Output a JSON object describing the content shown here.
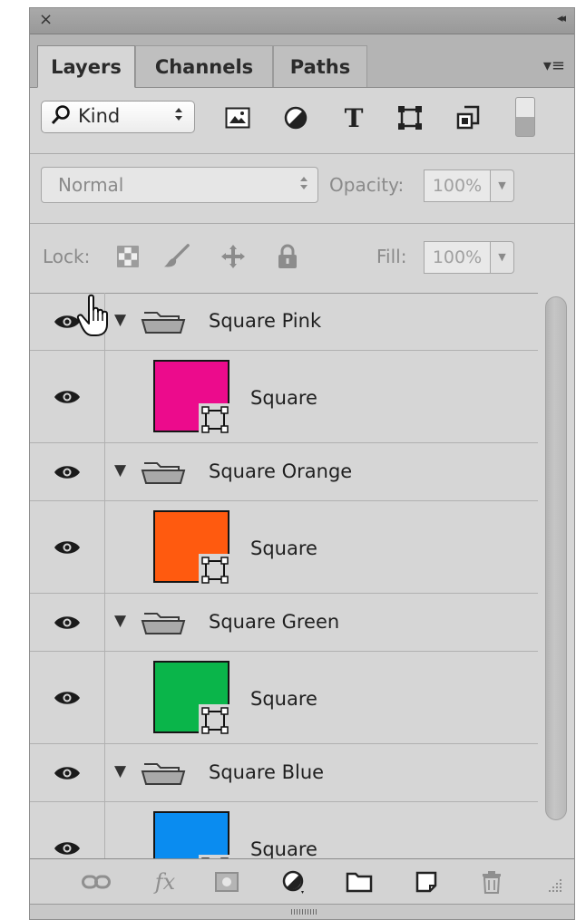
{
  "panel": {
    "close_glyph": "×",
    "collapse_glyph": "◂◂",
    "menu_glyph": "▾≡",
    "tabs": [
      {
        "label": "Layers",
        "active": true
      },
      {
        "label": "Channels",
        "active": false
      },
      {
        "label": "Paths",
        "active": false
      }
    ]
  },
  "filter": {
    "kind_label": "Kind",
    "icons": [
      "image-filter-icon",
      "adjustment-filter-icon",
      "type-filter-icon",
      "shape-filter-icon",
      "smart-object-filter-icon"
    ],
    "type_glyph": "T"
  },
  "blend": {
    "mode": "Normal",
    "opacity_label": "Opacity:",
    "opacity_value": "100%"
  },
  "lock": {
    "label": "Lock:",
    "fill_label": "Fill:",
    "fill_value": "100%"
  },
  "layers": [
    {
      "type": "group",
      "name": "Square Pink",
      "visible": true
    },
    {
      "type": "shape",
      "name": "Square",
      "color": "#ec0b8c",
      "visible": true
    },
    {
      "type": "group",
      "name": "Square Orange",
      "visible": true
    },
    {
      "type": "shape",
      "name": "Square",
      "color": "#ff5a0f",
      "visible": true
    },
    {
      "type": "group",
      "name": "Square Green",
      "visible": true
    },
    {
      "type": "shape",
      "name": "Square",
      "color": "#0ab54a",
      "visible": true
    },
    {
      "type": "group",
      "name": "Square Blue",
      "visible": true
    },
    {
      "type": "shape",
      "name": "Square",
      "color": "#0a8cf0",
      "visible": true
    }
  ],
  "bottom_toolbar": [
    "link-layers-icon",
    "fx-icon",
    "add-mask-icon",
    "new-adjustment-icon",
    "new-group-icon",
    "new-layer-icon",
    "delete-icon"
  ],
  "fx_label": "fx"
}
